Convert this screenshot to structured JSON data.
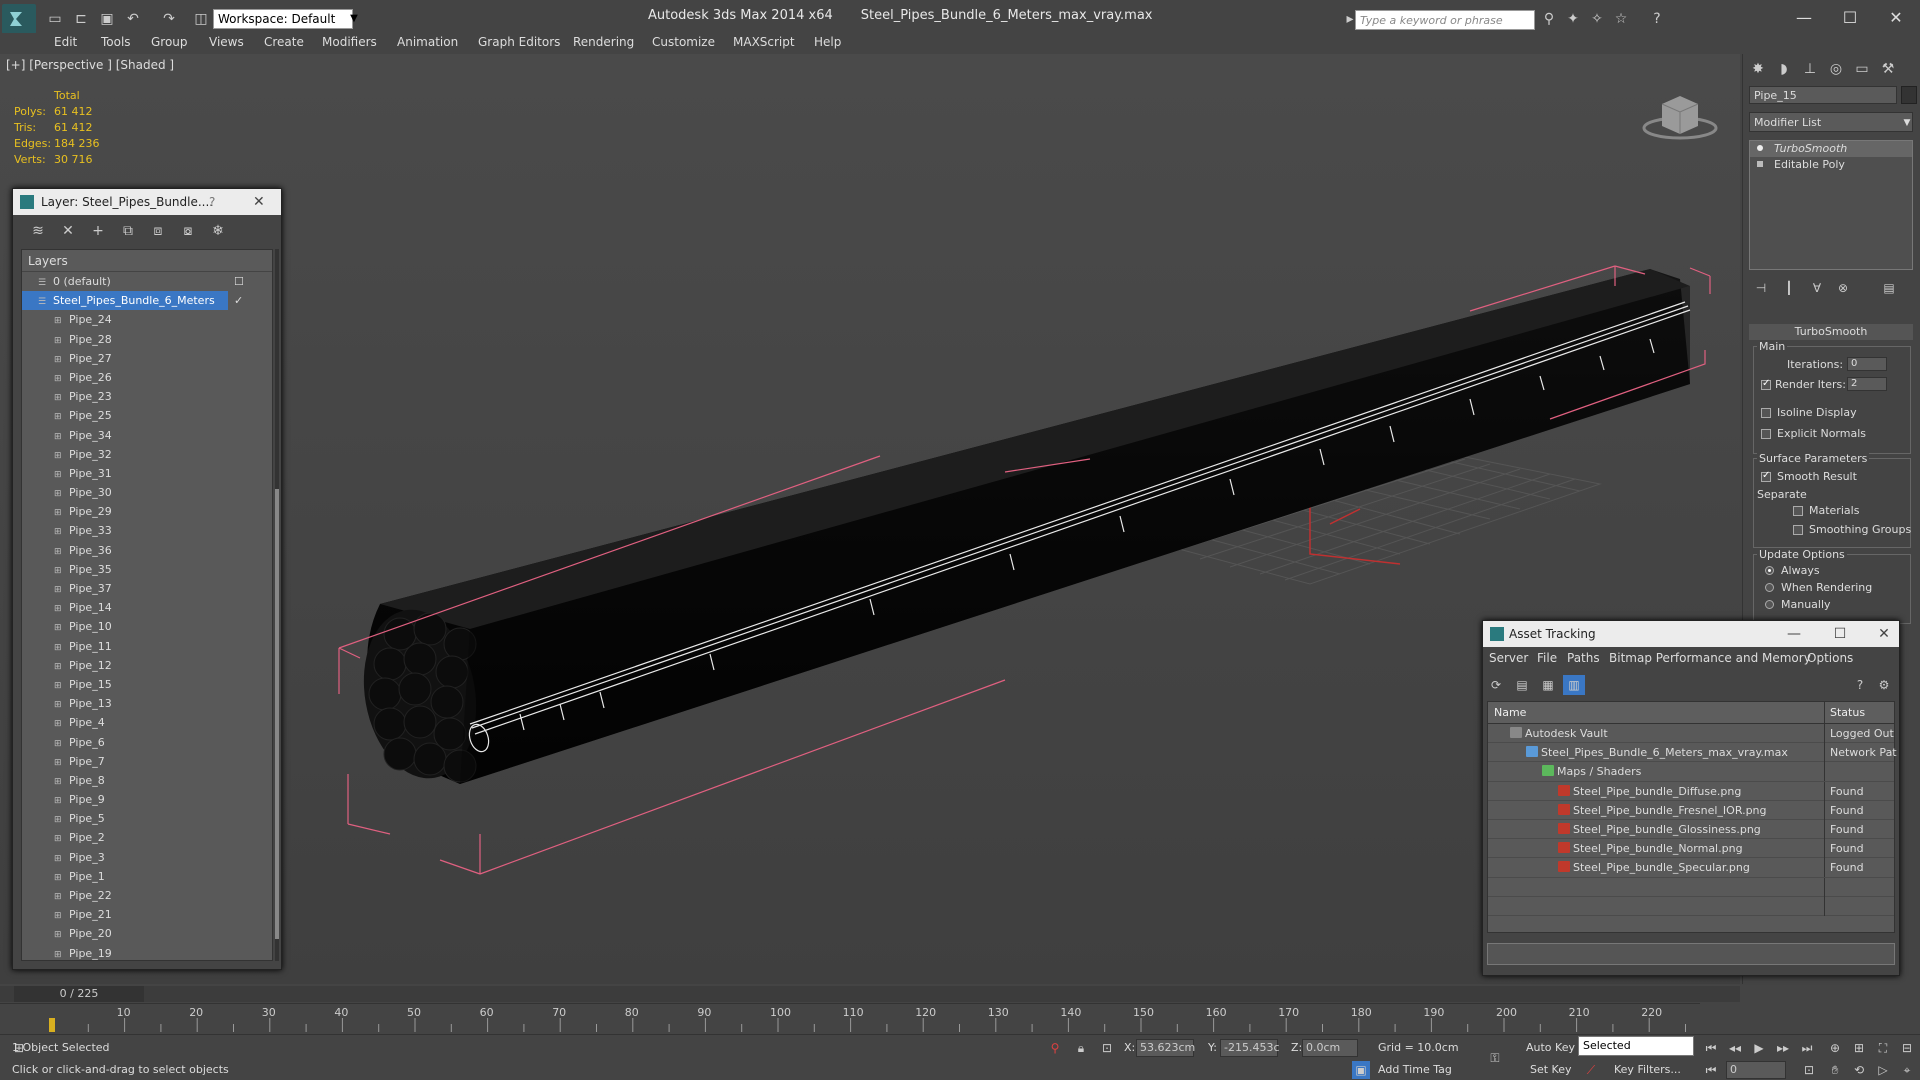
{
  "titlebar": {
    "workspace": "Workspace: Default",
    "app_name": "Autodesk 3ds Max  2014 x64",
    "file_name": "Steel_Pipes_Bundle_6_Meters_max_vray.max",
    "search_placeholder": "Type a keyword or phrase"
  },
  "menu": [
    "Edit",
    "Tools",
    "Group",
    "Views",
    "Create",
    "Modifiers",
    "Animation",
    "Graph Editors",
    "Rendering",
    "Customize",
    "MAXScript",
    "Help"
  ],
  "viewport": {
    "label": "[+] [Perspective ] [Shaded ]",
    "stats_header": "Total",
    "stats": [
      {
        "label": "Polys:",
        "value": "61 412"
      },
      {
        "label": "Tris:",
        "value": "61 412"
      },
      {
        "label": "Edges:",
        "value": "184 236"
      },
      {
        "label": "Verts:",
        "value": "30 716"
      }
    ]
  },
  "layer_panel": {
    "title": "Layer: Steel_Pipes_Bundle....",
    "help": "?",
    "header": "Layers",
    "rows": [
      {
        "name": "0 (default)",
        "level": 0,
        "selected": false
      },
      {
        "name": "Steel_Pipes_Bundle_6_Meters",
        "level": 0,
        "selected": true
      },
      {
        "name": "Pipe_24",
        "level": 1
      },
      {
        "name": "Pipe_28",
        "level": 1
      },
      {
        "name": "Pipe_27",
        "level": 1
      },
      {
        "name": "Pipe_26",
        "level": 1
      },
      {
        "name": "Pipe_23",
        "level": 1
      },
      {
        "name": "Pipe_25",
        "level": 1
      },
      {
        "name": "Pipe_34",
        "level": 1
      },
      {
        "name": "Pipe_32",
        "level": 1
      },
      {
        "name": "Pipe_31",
        "level": 1
      },
      {
        "name": "Pipe_30",
        "level": 1
      },
      {
        "name": "Pipe_29",
        "level": 1
      },
      {
        "name": "Pipe_33",
        "level": 1
      },
      {
        "name": "Pipe_36",
        "level": 1
      },
      {
        "name": "Pipe_35",
        "level": 1
      },
      {
        "name": "Pipe_37",
        "level": 1
      },
      {
        "name": "Pipe_14",
        "level": 1
      },
      {
        "name": "Pipe_10",
        "level": 1
      },
      {
        "name": "Pipe_11",
        "level": 1
      },
      {
        "name": "Pipe_12",
        "level": 1
      },
      {
        "name": "Pipe_15",
        "level": 1
      },
      {
        "name": "Pipe_13",
        "level": 1
      },
      {
        "name": "Pipe_4",
        "level": 1
      },
      {
        "name": "Pipe_6",
        "level": 1
      },
      {
        "name": "Pipe_7",
        "level": 1
      },
      {
        "name": "Pipe_8",
        "level": 1
      },
      {
        "name": "Pipe_9",
        "level": 1
      },
      {
        "name": "Pipe_5",
        "level": 1
      },
      {
        "name": "Pipe_2",
        "level": 1
      },
      {
        "name": "Pipe_3",
        "level": 1
      },
      {
        "name": "Pipe_1",
        "level": 1
      },
      {
        "name": "Pipe_22",
        "level": 1
      },
      {
        "name": "Pipe_21",
        "level": 1
      },
      {
        "name": "Pipe_20",
        "level": 1
      },
      {
        "name": "Pipe_19",
        "level": 1
      }
    ]
  },
  "command_panel": {
    "object_name": "Pipe_15",
    "modifier_list": "Modifier List",
    "stack": [
      "TurboSmooth",
      "Editable Poly"
    ],
    "rollout_title": "TurboSmooth",
    "main_label": "Main",
    "iterations_label": "Iterations:",
    "iterations_value": "0",
    "render_iters_label": "Render Iters:",
    "render_iters_value": "2",
    "isoline_label": "Isoline Display",
    "explicit_normals_label": "Explicit Normals",
    "surface_params_label": "Surface Parameters",
    "smooth_result_label": "Smooth Result",
    "separate_label": "Separate",
    "materials_label": "Materials",
    "smoothing_groups_label": "Smoothing Groups",
    "update_options_label": "Update Options",
    "always_label": "Always",
    "when_rendering_label": "When Rendering",
    "manually_label": "Manually"
  },
  "asset_panel": {
    "title": "Asset Tracking",
    "menu": [
      "Server",
      "File",
      "Paths",
      "Bitmap Performance and Memory",
      "Options"
    ],
    "col_name": "Name",
    "col_status": "Status",
    "rows": [
      {
        "name": "Autodesk Vault",
        "status": "Logged Out",
        "indent": 1,
        "kind": "vault"
      },
      {
        "name": "Steel_Pipes_Bundle_6_Meters_max_vray.max",
        "status": "Network Pat",
        "indent": 2,
        "kind": "max"
      },
      {
        "name": "Maps / Shaders",
        "status": "",
        "indent": 3,
        "kind": "maps"
      },
      {
        "name": "Steel_Pipe_bundle_Diffuse.png",
        "status": "Found",
        "indent": 4,
        "kind": "png"
      },
      {
        "name": "Steel_Pipe_bundle_Fresnel_IOR.png",
        "status": "Found",
        "indent": 4,
        "kind": "png"
      },
      {
        "name": "Steel_Pipe_bundle_Glossiness.png",
        "status": "Found",
        "indent": 4,
        "kind": "png"
      },
      {
        "name": "Steel_Pipe_bundle_Normal.png",
        "status": "Found",
        "indent": 4,
        "kind": "png"
      },
      {
        "name": "Steel_Pipe_bundle_Specular.png",
        "status": "Found",
        "indent": 4,
        "kind": "png"
      },
      {
        "name": "",
        "status": "",
        "indent": 0,
        "kind": ""
      },
      {
        "name": "",
        "status": "",
        "indent": 0,
        "kind": ""
      }
    ]
  },
  "timeline": {
    "frame_label": "0 / 225",
    "ticks": [
      "10",
      "20",
      "30",
      "40",
      "50",
      "60",
      "70",
      "80",
      "90",
      "100",
      "110",
      "120",
      "130",
      "140",
      "150",
      "160",
      "170",
      "180",
      "190",
      "200",
      "210",
      "220"
    ]
  },
  "statusbar": {
    "selection": "1 Object Selected",
    "prompt": "Click or click-and-drag to select objects",
    "x_label": "X:",
    "x_value": "53.623cm",
    "y_label": "Y:",
    "y_value": "-215.453c",
    "z_label": "Z:",
    "z_value": "0.0cm",
    "grid": "Grid = 10.0cm",
    "add_time_tag": "Add Time Tag",
    "auto_key": "Auto Key",
    "set_key": "Set Key",
    "selected": "Selected",
    "key_filters": "Key Filters...",
    "frame": "0"
  },
  "colors": {
    "selection_blue": "#3a77c4",
    "stats_yellow": "#e8c020",
    "bbox_pink": "#e06080"
  }
}
